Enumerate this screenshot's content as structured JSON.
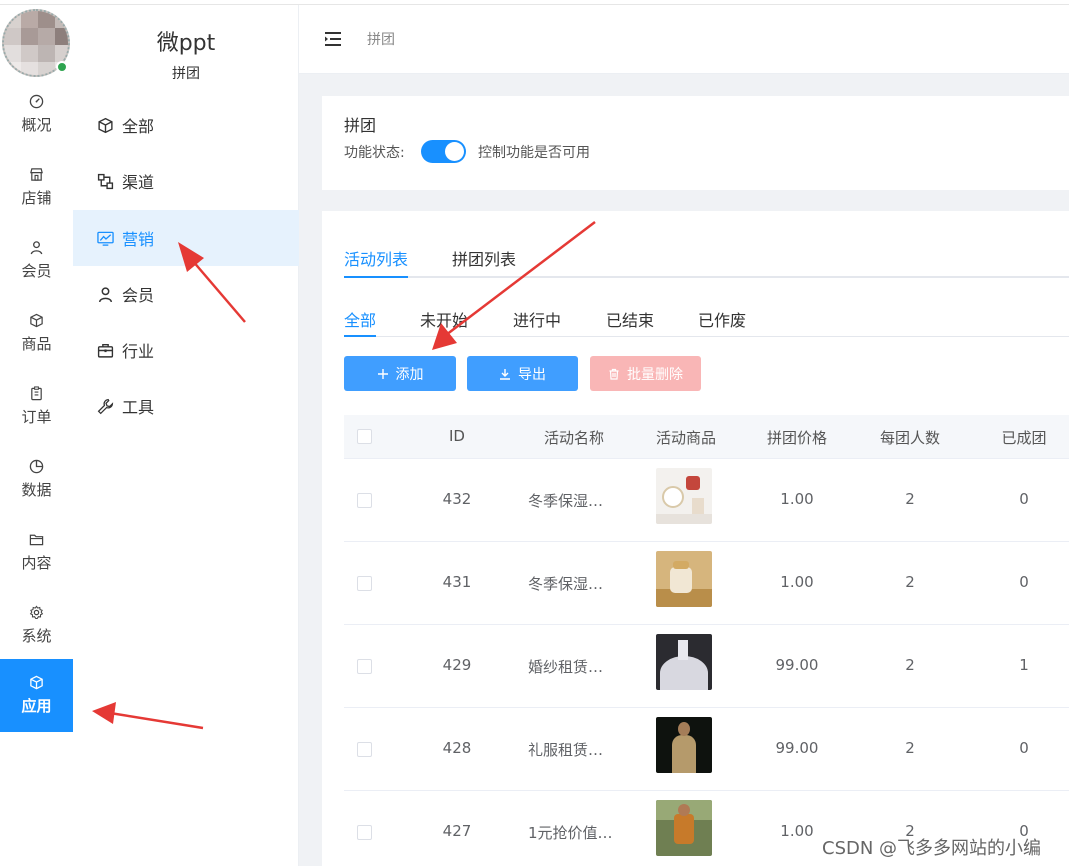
{
  "rail": {
    "items": [
      {
        "label": "概况",
        "icon": "dashboard-icon"
      },
      {
        "label": "店铺",
        "icon": "shop-icon"
      },
      {
        "label": "会员",
        "icon": "user-icon"
      },
      {
        "label": "商品",
        "icon": "box-icon"
      },
      {
        "label": "订单",
        "icon": "clipboard-icon"
      },
      {
        "label": "数据",
        "icon": "pie-chart-icon"
      },
      {
        "label": "内容",
        "icon": "folder-icon"
      },
      {
        "label": "系统",
        "icon": "gear-icon"
      },
      {
        "label": "应用",
        "icon": "app-box-icon"
      }
    ],
    "active": "应用"
  },
  "brand": {
    "title": "微ppt",
    "subtitle": "拼团"
  },
  "sub_menu": {
    "items": [
      {
        "label": "全部",
        "icon": "cube-icon"
      },
      {
        "label": "渠道",
        "icon": "channel-icon"
      },
      {
        "label": "营销",
        "icon": "marketing-chart-icon"
      },
      {
        "label": "会员",
        "icon": "user-icon"
      },
      {
        "label": "行业",
        "icon": "briefcase-icon"
      },
      {
        "label": "工具",
        "icon": "wrench-icon"
      }
    ],
    "active": "营销"
  },
  "header": {
    "breadcrumb": "拼团"
  },
  "feature": {
    "title": "拼团",
    "status_label": "功能状态:",
    "enabled": true,
    "description": "控制功能是否可用"
  },
  "tabs_main": [
    "活动列表",
    "拼团列表"
  ],
  "tabs_status": [
    "全部",
    "未开始",
    "进行中",
    "已结束",
    "已作废"
  ],
  "buttons": {
    "add": "添加",
    "export": "导出",
    "batch_delete": "批量删除"
  },
  "table": {
    "columns": [
      "ID",
      "活动名称",
      "活动商品",
      "拼团价格",
      "每团人数",
      "已成团"
    ],
    "rows": [
      {
        "id": "432",
        "name": "冬季保湿…",
        "price": "1.00",
        "group_size": "2",
        "formed": "0"
      },
      {
        "id": "431",
        "name": "冬季保湿…",
        "price": "1.00",
        "group_size": "2",
        "formed": "0"
      },
      {
        "id": "429",
        "name": "婚纱租赁…",
        "price": "99.00",
        "group_size": "2",
        "formed": "1"
      },
      {
        "id": "428",
        "name": "礼服租赁…",
        "price": "99.00",
        "group_size": "2",
        "formed": "0"
      },
      {
        "id": "427",
        "name": "1元抢价值…",
        "price": "1.00",
        "group_size": "2",
        "formed": "0"
      }
    ]
  },
  "watermark": "CSDN @飞多多网站的小编",
  "colors": {
    "accent": "#1890ff",
    "button_primary": "#409eff",
    "button_danger_disabled": "#f9b6b6",
    "arrow": "#e53935"
  }
}
